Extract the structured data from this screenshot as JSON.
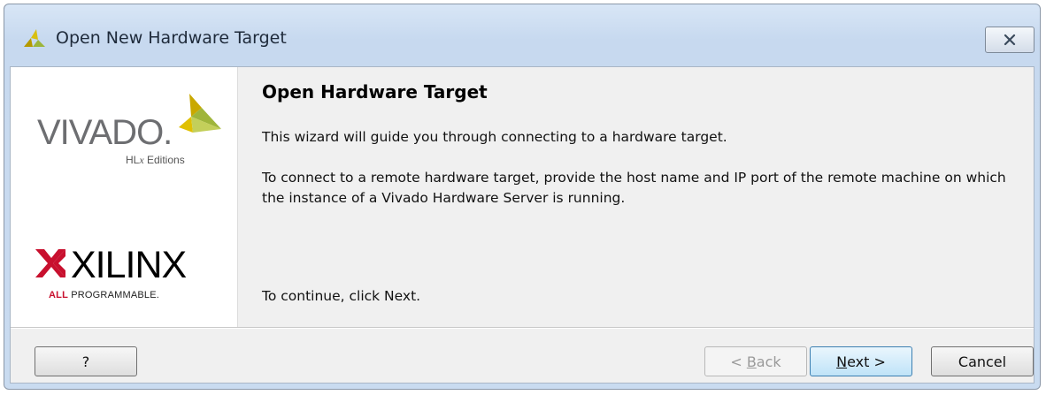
{
  "window": {
    "title": "Open New Hardware Target",
    "close_icon": "close-icon",
    "app_icon": "vivado-leaf-icon"
  },
  "brand": {
    "vivado_word": "VIVADO.",
    "vivado_sub_prefix": "HL",
    "vivado_sub_italic": "x",
    "vivado_sub_suffix": " Editions",
    "xilinx_word": "XILINX",
    "xilinx_tag_red": "ALL",
    "xilinx_tag_rest": " PROGRAMMABLE.",
    "vivado_colors": [
      "#d4b106",
      "#9fb53a",
      "#e8c300"
    ],
    "xilinx_red": "#c8102e"
  },
  "page": {
    "heading": "Open Hardware Target",
    "para1": "This wizard will guide you through connecting to a hardware target.",
    "para2": "To connect to a remote hardware target, provide the host name and IP port of the remote machine on which the instance of a Vivado Hardware Server is running.",
    "para3": "To continue, click Next."
  },
  "buttons": {
    "help": "?",
    "back_prefix": "< ",
    "back_mnemonic": "B",
    "back_rest": "ack",
    "next_mnemonic": "N",
    "next_rest": "ext >",
    "cancel": "Cancel"
  }
}
